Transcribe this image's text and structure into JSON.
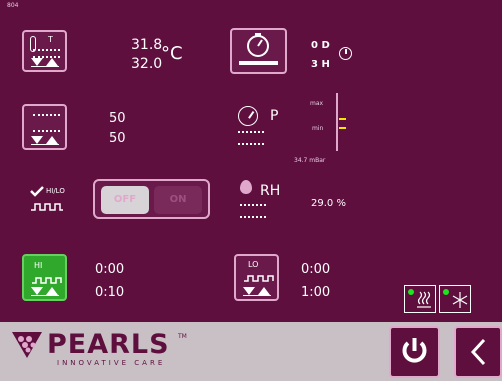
{
  "screen_id": "804",
  "temperature": {
    "tile_label": "T",
    "setpoint": "31.8",
    "actual": "32.0",
    "unit": "°C"
  },
  "timer": {
    "days_value": "0 D",
    "hours_value": "3 H"
  },
  "heating": {
    "setpoint": "50",
    "actual": "50"
  },
  "pressure": {
    "label": "P",
    "max_label": "max",
    "min_label": "min",
    "reading": "34.7 mBar"
  },
  "hilo": {
    "label": "HI/LO",
    "off_label": "OFF",
    "on_label": "ON"
  },
  "humidity": {
    "label": "RH",
    "value": "29.0 %"
  },
  "hi_timer": {
    "label": "HI",
    "time1": "0:00",
    "time2": "0:10"
  },
  "lo_timer": {
    "label": "LO",
    "time1": "0:00",
    "time2": "1:00"
  },
  "brand": {
    "name": "PEARLS",
    "tm": "TM",
    "tagline": "INNOVATIVE CARE"
  },
  "colors": {
    "background": "#5e0f3e",
    "tile_border": "#e0a9cc",
    "active_green": "#2fa82b",
    "indicator_yellow": "#f1e800",
    "bottom_bar": "#c9c0c6"
  },
  "icons": [
    "thermometer-icon",
    "timer-icon",
    "heater-icon",
    "pressure-gauge-icon",
    "humidity-drop-icon",
    "clock-icon",
    "power-icon",
    "back-chevron-icon"
  ]
}
